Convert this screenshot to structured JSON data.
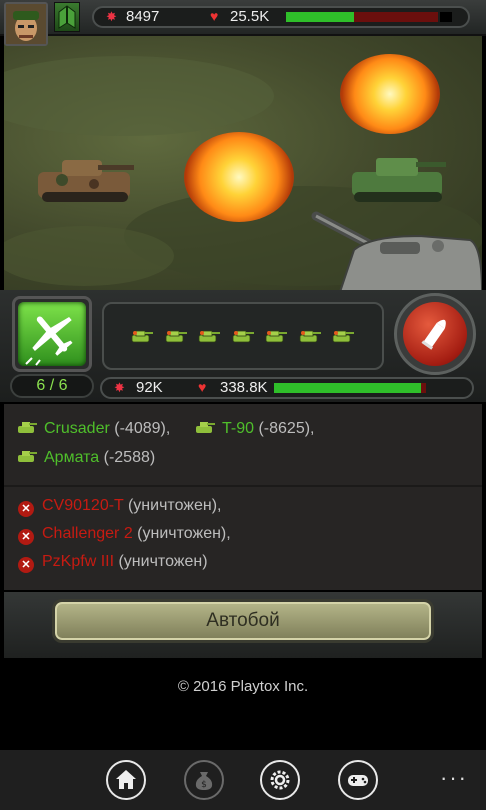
{
  "header": {
    "power_icon": "explosion-icon",
    "power_value": "8497",
    "hp_icon": "heart-icon",
    "hp_value": "25.5K",
    "hp_fraction": 0.45
  },
  "controls": {
    "airstrike_icon": "airplane-icon",
    "airstrike_count": "6 / 6",
    "reserve_tanks": 7,
    "fire_icon": "shell-icon",
    "enemy_power_value": "92K",
    "enemy_hp_value": "338.8K",
    "enemy_hp_fraction": 0.97
  },
  "log": {
    "damaged": [
      {
        "name": "Crusader",
        "detail": " (-4089),"
      },
      {
        "name": "T-90",
        "detail": " (-8625),"
      },
      {
        "name": "Армата",
        "detail": " (-2588)"
      }
    ],
    "destroyed": [
      {
        "name": "CV90120-T",
        "detail": " (уничтожен),"
      },
      {
        "name": "Challenger 2",
        "detail": " (уничтожен),"
      },
      {
        "name": "PzKpfw III",
        "detail": " (уничтожен)"
      }
    ]
  },
  "autobattle_label": "Автобой",
  "copyright": "© 2016 Playtox Inc.",
  "appbar": {
    "items": [
      "home-icon",
      "money-bag-icon",
      "gear-icon",
      "gamepad-icon"
    ],
    "more": "···"
  },
  "colors": {
    "ally_green": "#4fbf2b",
    "enemy_red": "#c61b12",
    "hp_green": "#2fbf2a"
  }
}
